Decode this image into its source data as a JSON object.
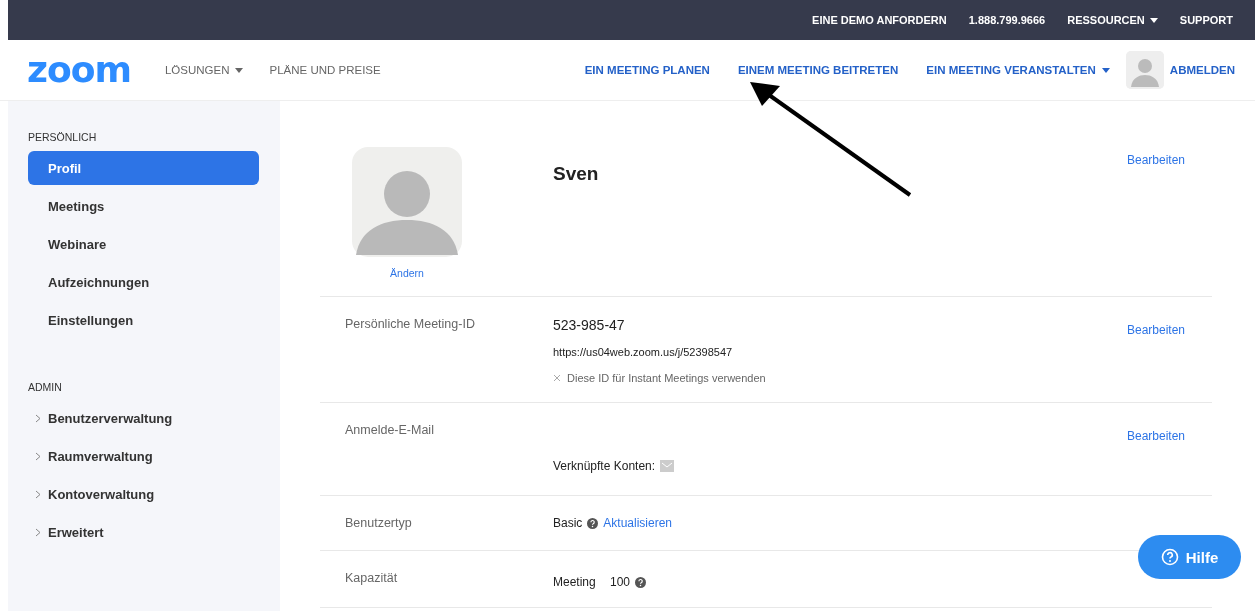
{
  "top_bar": {
    "links": [
      {
        "label": "EINE DEMO ANFORDERN",
        "dropdown": false
      },
      {
        "label": "1.888.799.9666",
        "dropdown": false
      },
      {
        "label": "RESSOURCEN",
        "dropdown": true
      },
      {
        "label": "SUPPORT",
        "dropdown": false
      }
    ]
  },
  "nav": {
    "logo": "zoom",
    "left": [
      {
        "label": "LÖSUNGEN",
        "dropdown": true
      },
      {
        "label": "PLÄNE UND PREISE",
        "dropdown": false
      }
    ],
    "right": [
      {
        "label": "EIN MEETING PLANEN",
        "dropdown": false
      },
      {
        "label": "EINEM MEETING BEITRETEN",
        "dropdown": false
      },
      {
        "label": "EIN MEETING VERANSTALTEN",
        "dropdown": true
      }
    ],
    "signout": "ABMELDEN"
  },
  "sidebar": {
    "sections": [
      {
        "heading": "PERSÖNLICH",
        "items": [
          {
            "label": "Profil",
            "selected": true
          },
          {
            "label": "Meetings",
            "selected": false
          },
          {
            "label": "Webinare",
            "selected": false
          },
          {
            "label": "Aufzeichnungen",
            "selected": false
          },
          {
            "label": "Einstellungen",
            "selected": false
          }
        ]
      },
      {
        "heading": "ADMIN",
        "items": [
          {
            "label": "Benutzerverwaltung",
            "selected": false,
            "expanded": false
          },
          {
            "label": "Raumverwaltung",
            "selected": false,
            "expanded": false
          },
          {
            "label": "Kontoverwaltung",
            "selected": false,
            "expanded": false
          },
          {
            "label": "Erweitert",
            "selected": false,
            "expanded": false
          }
        ]
      }
    ]
  },
  "profile": {
    "change_link": "Ändern",
    "name": "Sven",
    "edit": "Bearbeiten"
  },
  "rows": [
    {
      "kind": "meeting_id",
      "label": "Persönliche Meeting-ID",
      "value": "523-985-47",
      "url": "https://us04web.zoom.us/j/52398547",
      "option": "Diese ID für Instant Meetings verwenden",
      "checked": false,
      "edit": "Bearbeiten"
    },
    {
      "kind": "email",
      "label": "Anmelde-E-Mail",
      "linked": "Verknüpfte Konten:",
      "edit": "Bearbeiten"
    },
    {
      "kind": "user_type",
      "label": "Benutzertyp",
      "value": "Basic",
      "link": "Aktualisieren"
    },
    {
      "kind": "capacity",
      "label": "Kapazität",
      "value": "Meeting",
      "amount": "100"
    }
  ],
  "help_button": "Hilfe"
}
